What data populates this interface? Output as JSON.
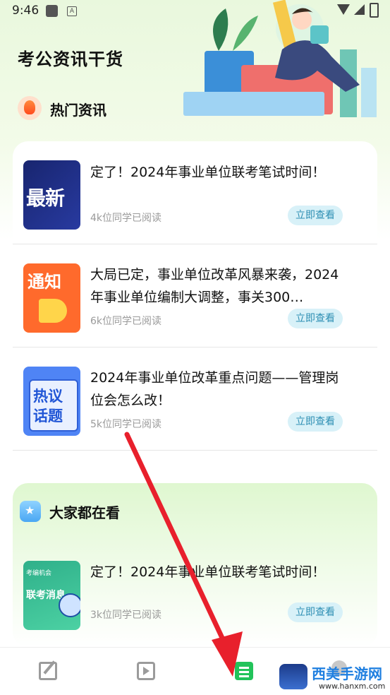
{
  "status_bar": {
    "time": "9:46",
    "a_badge": "A"
  },
  "page_title": "考公资讯干货",
  "hot_section": {
    "label": "热门资讯",
    "icon": "fire-icon"
  },
  "hot_articles": [
    {
      "thumb_text": "最新",
      "title": "定了！2024年事业单位联考笔试时间！",
      "reads": "4k位同学已阅读",
      "button": "立即查看"
    },
    {
      "thumb_text": "通知",
      "title": "大局已定，事业单位改革风暴来袭，2024年事业单位编制大调整，事关300…",
      "reads": "6k位同学已阅读",
      "button": "立即查看"
    },
    {
      "thumb_text_1": "热议",
      "thumb_text_2": "话题",
      "title": "2024年事业单位改革重点问题——管理岗位会怎么改！",
      "reads": "5k位同学已阅读",
      "button": "立即查看"
    }
  ],
  "popular_section": {
    "label": "大家都在看",
    "icon": "star-home-icon",
    "article": {
      "thumb_text_1": "考编机会",
      "thumb_text_2": "联考消息",
      "title": "定了！2024年事业单位联考笔试时间！",
      "reads": "3k位同学已阅读",
      "button": "立即查看"
    }
  },
  "tab_bar": [
    {
      "name": "edit-tab",
      "icon": "edit-icon",
      "active": false
    },
    {
      "name": "video-tab",
      "icon": "video-icon",
      "active": false
    },
    {
      "name": "news-tab",
      "icon": "news-icon",
      "active": true
    },
    {
      "name": "profile-tab",
      "icon": "profile-icon",
      "active": false
    }
  ],
  "watermark": {
    "title": "西美手游网",
    "url": "www.hanxm.com"
  },
  "colors": {
    "accent_green": "#22c35a",
    "button_bg": "#d8f1f8",
    "button_text": "#2e8fb3",
    "arrow_red": "#e8202c"
  }
}
